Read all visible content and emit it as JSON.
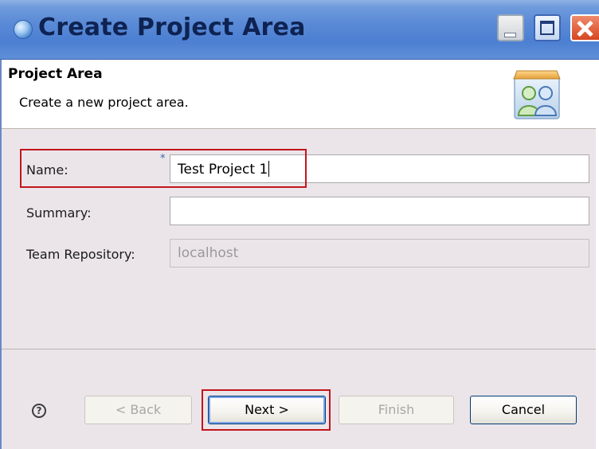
{
  "window": {
    "title": "Create Project Area",
    "icon": "wizard-globe-icon"
  },
  "header": {
    "title": "Project Area",
    "description": "Create a new project area.",
    "icon": "project-area-people-icon"
  },
  "form": {
    "name": {
      "label": "Name:",
      "required_marker": "*",
      "value": "Test Project 1"
    },
    "summary": {
      "label": "Summary:",
      "value": ""
    },
    "repository": {
      "label": "Team Repository:",
      "value": "localhost"
    }
  },
  "buttons": {
    "help": "?",
    "back": "< Back",
    "next": "Next >",
    "finish": "Finish",
    "cancel": "Cancel"
  },
  "colors": {
    "highlight": "#c2151c",
    "dialog_background": "#ebe5ea",
    "title_bar": "#5a8ad6"
  }
}
